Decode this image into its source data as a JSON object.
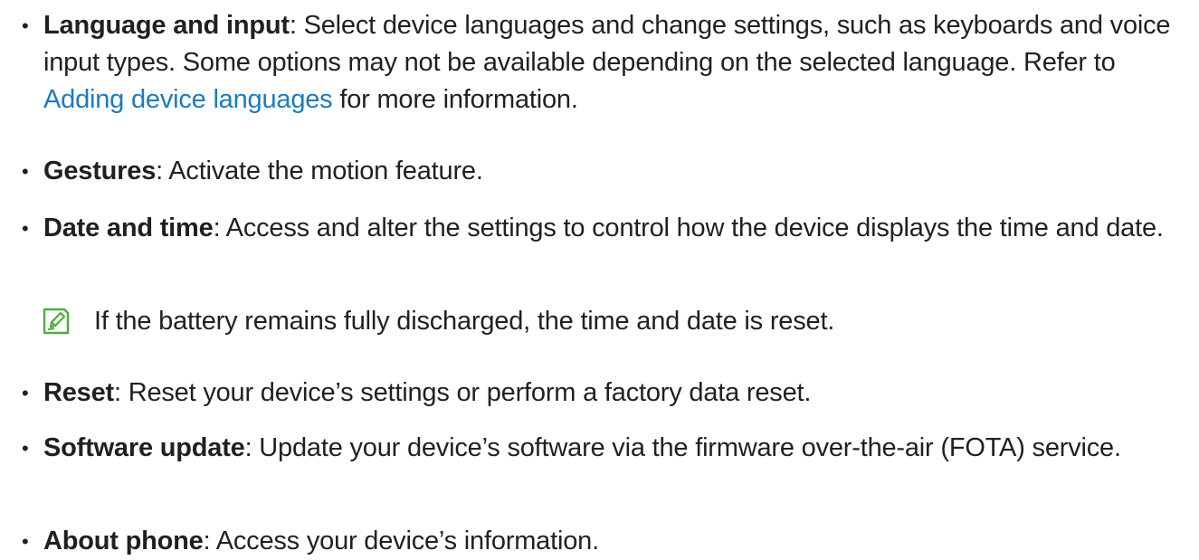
{
  "items": [
    {
      "term": "Language and input",
      "text_before": ": Select device languages and change settings, such as keyboards and voice input types. Some options may not be available depending on the selected language. Refer to ",
      "link": "Adding device languages",
      "text_after": " for more information."
    },
    {
      "term": "Gestures",
      "text": ": Activate the motion feature."
    },
    {
      "term": "Date and time",
      "text": ": Access and alter the settings to control how the device displays the time and date.",
      "note": "If the battery remains fully discharged, the time and date is reset."
    },
    {
      "term": "Reset",
      "text": ": Reset your device’s settings or perform a factory data reset."
    },
    {
      "term": "Software update",
      "text": ": Update your device’s software via the firmware over-the-air (FOTA) service."
    },
    {
      "term": "About phone",
      "text": ": Access your device’s information."
    }
  ],
  "icons": {
    "bullet": "•",
    "note_icon": "pencil-note-icon"
  },
  "colors": {
    "text": "#231f20",
    "link": "#1a7bc0",
    "note_icon": "#4caf3c"
  }
}
